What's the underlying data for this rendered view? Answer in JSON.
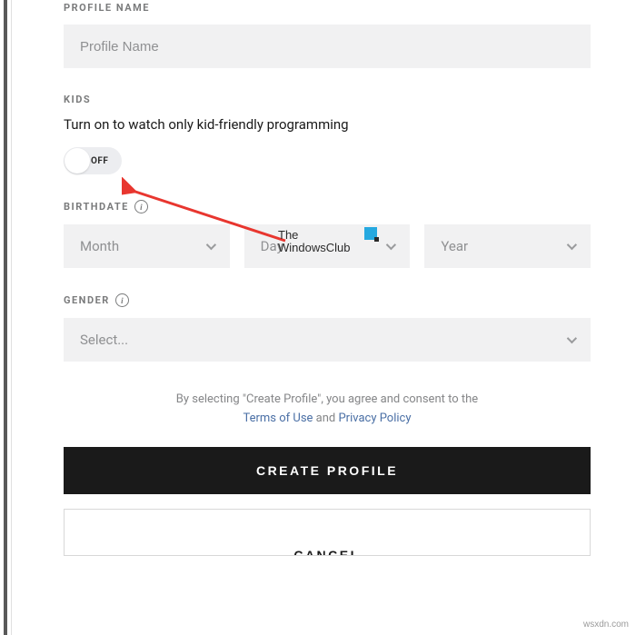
{
  "labels": {
    "profileName": "PROFILE NAME",
    "kids": "KIDS",
    "birthdate": "BIRTHDATE",
    "gender": "GENDER"
  },
  "profileName": {
    "placeholder": "Profile Name"
  },
  "kids": {
    "description": "Turn on to watch only kid-friendly programming",
    "toggleState": "OFF"
  },
  "birthdate": {
    "month": "Month",
    "day": "Day",
    "year": "Year"
  },
  "gender": {
    "selected": "Select..."
  },
  "disclaimer": {
    "prefix": "By selecting \"Create Profile\", you agree and consent to the",
    "termsLink": "Terms of Use",
    "joiner": " and ",
    "privacyLink": "Privacy Policy"
  },
  "buttons": {
    "create": "CREATE PROFILE",
    "cancel": "CANCEL"
  },
  "watermark": {
    "line1": "The",
    "line2": "WindowsClub"
  },
  "attribution": "wsxdn.com"
}
